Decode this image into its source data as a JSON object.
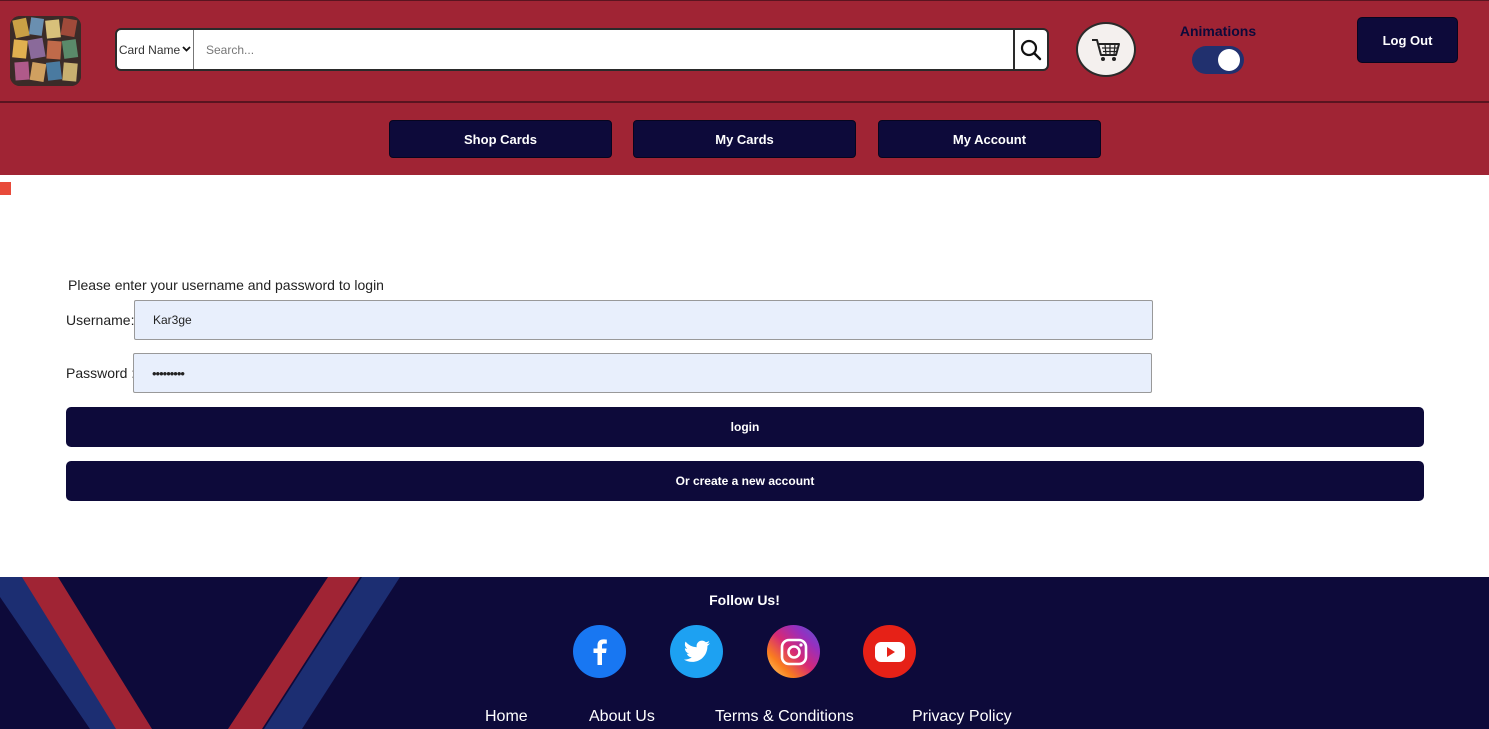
{
  "header": {
    "search": {
      "category": "Card Name",
      "placeholder": "Search..."
    },
    "animations_label": "Animations",
    "animations_enabled": true,
    "logout_label": "Log Out"
  },
  "nav": {
    "items": [
      {
        "label": "Shop Cards"
      },
      {
        "label": "My Cards"
      },
      {
        "label": "My Account"
      }
    ]
  },
  "login": {
    "prompt": "Please enter your username and password to login",
    "username_label": "Username:",
    "username_value": "Kar3ge",
    "password_label": "Password :",
    "password_value": "•••••••••",
    "login_label": "login",
    "create_label": "Or create a new account"
  },
  "footer": {
    "follow": "Follow Us!",
    "social": [
      {
        "icon": "facebook-icon",
        "color": "#1877f2"
      },
      {
        "icon": "twitter-icon",
        "color": "#1da1f2"
      },
      {
        "icon": "instagram-icon",
        "color": "#d62976"
      },
      {
        "icon": "youtube-icon",
        "color": "#e62117"
      }
    ],
    "links": [
      {
        "label": "Home"
      },
      {
        "label": "About Us"
      },
      {
        "label": "Terms & Conditions"
      },
      {
        "label": "Privacy Policy"
      }
    ]
  },
  "colors": {
    "header_bg": "#a02434",
    "navy": "#0d0a3a",
    "input_bg": "#e8effc"
  }
}
